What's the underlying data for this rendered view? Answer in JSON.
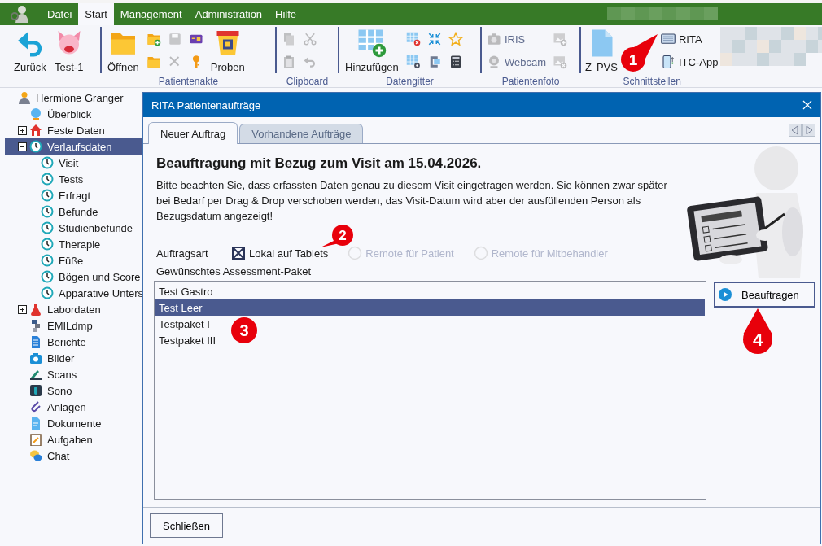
{
  "menu": [
    {
      "label": "Datei",
      "selected": false
    },
    {
      "label": "Start",
      "selected": true
    },
    {
      "label": "Management",
      "selected": false
    },
    {
      "label": "Administration",
      "selected": false
    },
    {
      "label": "Hilfe",
      "selected": false
    }
  ],
  "ribbon": {
    "groups": [
      {
        "items": [
          {
            "kind": "large",
            "label": "Zurück",
            "disabled": false
          },
          {
            "kind": "large",
            "label": "Test-1",
            "disabled": false
          }
        ]
      },
      {
        "label": "Patientenakte",
        "items": [
          {
            "kind": "large",
            "label": "Öffnen",
            "disabled": false
          },
          {
            "kind": "small",
            "disabled": false
          },
          {
            "kind": "small",
            "disabled": false
          },
          {
            "kind": "small",
            "disabled": true
          },
          {
            "kind": "small",
            "disabled": true
          },
          {
            "kind": "small",
            "disabled": false
          },
          {
            "kind": "small",
            "disabled": false
          },
          {
            "kind": "large",
            "label": "Proben",
            "disabled": false
          }
        ]
      },
      {
        "label": "Clipboard",
        "items": [
          {
            "kind": "small",
            "disabled": true
          },
          {
            "kind": "small",
            "disabled": true
          },
          {
            "kind": "small",
            "disabled": true
          },
          {
            "kind": "small",
            "disabled": true
          }
        ]
      },
      {
        "label": "Datengitter",
        "items": [
          {
            "kind": "large",
            "label": "Hinzufügen",
            "disabled": false
          },
          {
            "kind": "small",
            "disabled": false
          },
          {
            "kind": "small",
            "disabled": false
          },
          {
            "kind": "small",
            "disabled": false
          },
          {
            "kind": "small",
            "disabled": false
          },
          {
            "kind": "small",
            "disabled": false
          },
          {
            "kind": "small",
            "disabled": false
          }
        ]
      },
      {
        "label": "Patientenfoto",
        "items": [
          {
            "kind": "small",
            "label": "IRIS",
            "disabled": true
          },
          {
            "kind": "small",
            "label": "Webcam",
            "disabled": true
          },
          {
            "kind": "small",
            "disabled": true
          },
          {
            "kind": "small",
            "disabled": true
          }
        ]
      },
      {
        "label": "Schnittstellen",
        "items": [
          {
            "kind": "large",
            "label_parts": [
              "Z",
              "PVS"
            ],
            "disabled": false
          },
          {
            "kind": "small",
            "label": "RITA",
            "disabled": false
          },
          {
            "kind": "small",
            "label": "ITC-App",
            "disabled": false
          }
        ]
      }
    ]
  },
  "tree": [
    {
      "label": "Hermione Granger",
      "selected": false,
      "children": [
        {
          "label": "Überblick",
          "selected": false
        },
        {
          "label": "Feste Daten",
          "selected": false,
          "expanded": false
        },
        {
          "label": "Verlaufsdaten",
          "selected": true,
          "expanded": true,
          "children": [
            {
              "label": "Visit",
              "selected": false
            },
            {
              "label": "Tests",
              "selected": false
            },
            {
              "label": "Erfragt",
              "selected": false
            },
            {
              "label": "Befunde",
              "selected": false
            },
            {
              "label": "Studienbefunde",
              "selected": false
            },
            {
              "label": "Therapie",
              "selected": false
            },
            {
              "label": "Füße",
              "selected": false
            },
            {
              "label": "Bögen und Score",
              "selected": false
            },
            {
              "label": "Apparative Unters",
              "selected": false
            }
          ]
        },
        {
          "label": "Labordaten",
          "selected": false,
          "expanded": false
        },
        {
          "label": "EMILdmp",
          "selected": false
        },
        {
          "label": "Berichte",
          "selected": false
        },
        {
          "label": "Bilder",
          "selected": false
        },
        {
          "label": "Scans",
          "selected": false
        },
        {
          "label": "Sono",
          "selected": false
        },
        {
          "label": "Anlagen",
          "selected": false
        },
        {
          "label": "Dokumente",
          "selected": false
        },
        {
          "label": "Aufgaben",
          "selected": false
        },
        {
          "label": "Chat",
          "selected": false
        }
      ]
    }
  ],
  "dialog": {
    "title": "RITA Patientenaufträge",
    "tabs": [
      {
        "label": "Neuer Auftrag",
        "selected": true
      },
      {
        "label": "Vorhandene Aufträge",
        "selected": false
      }
    ],
    "heading": "Beauftragung mit Bezug zum Visit am 15.04.2026.",
    "notice": "Bitte beachten Sie, dass erfassten Daten genau zu diesem Visit eingetragen werden. Sie können zwar später bei Bedarf per Drag & Drop verschoben werden, das Visit-Datum wird aber der ausfüllenden Person als Bezugsdatum angezeigt!",
    "order_type_label": "Auftragsart",
    "order_types": [
      {
        "kind": "checkbox",
        "label": "Lokal auf Tablets",
        "checked": true,
        "disabled": false
      },
      {
        "kind": "radio",
        "label": "Remote für Patient",
        "checked": false,
        "disabled": true
      },
      {
        "kind": "radio",
        "label": "Remote für Mitbehandler",
        "checked": false,
        "disabled": true
      }
    ],
    "package_label": "Gewünschtes Assessment-Paket",
    "packages": [
      {
        "label": "Test Gastro",
        "selected": false
      },
      {
        "label": "Test Leer",
        "selected": true
      },
      {
        "label": "Testpaket I",
        "selected": false
      },
      {
        "label": "Testpaket III",
        "selected": false
      }
    ],
    "submit_button": "Beauftragen",
    "close_button": "Schließen"
  },
  "callouts": [
    "1",
    "2",
    "3",
    "4"
  ]
}
